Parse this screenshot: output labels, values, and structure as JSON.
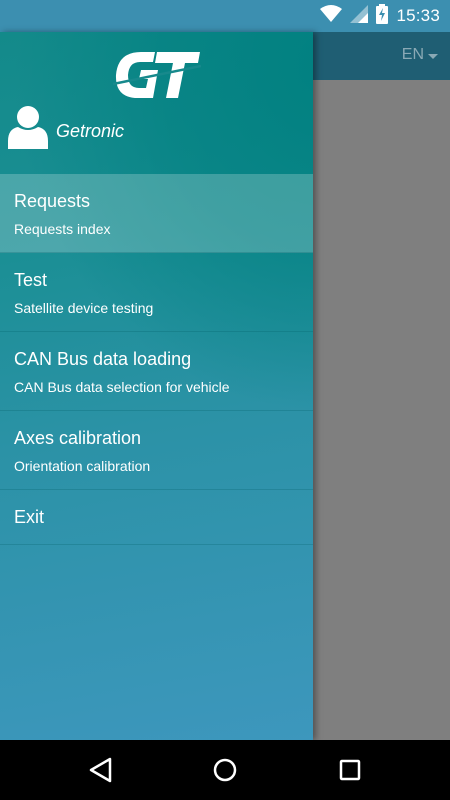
{
  "status_bar": {
    "time": "15:33",
    "icons": [
      "wifi-icon",
      "signal-icon",
      "battery-charging-icon"
    ]
  },
  "header": {
    "language": "EN"
  },
  "drawer": {
    "brand_logo": "GT",
    "user_name": "Getronic",
    "items": [
      {
        "title": "Requests",
        "subtitle": "Requests index",
        "active": true
      },
      {
        "title": "Test",
        "subtitle": "Satellite device testing",
        "active": false
      },
      {
        "title": "CAN Bus data loading",
        "subtitle": "CAN Bus data selection for vehicle",
        "active": false
      },
      {
        "title": "Axes calibration",
        "subtitle": "Orientation calibration",
        "active": false
      },
      {
        "title": "Exit",
        "subtitle": "",
        "active": false
      }
    ]
  },
  "nav_bar": {
    "buttons": [
      "back-icon",
      "home-icon",
      "recents-icon"
    ]
  },
  "colors": {
    "drawer_teal": "#138a8a",
    "drawer_blue": "#3d97bd",
    "status_bar": "#3c8fb0",
    "header": "#1f5e73",
    "scrim": "#7f7f7f"
  }
}
